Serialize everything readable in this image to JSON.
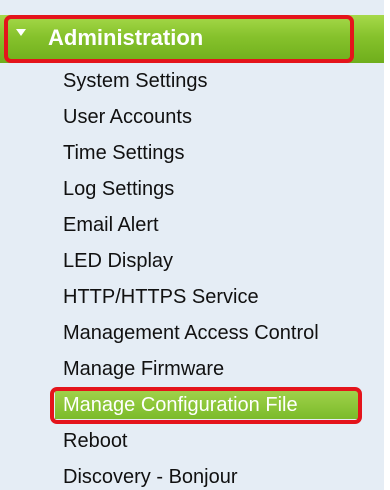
{
  "section": {
    "title": "Administration",
    "expanded_icon": "caret-down-icon"
  },
  "menu": {
    "items": [
      {
        "label": "System Settings"
      },
      {
        "label": "User Accounts"
      },
      {
        "label": "Time Settings"
      },
      {
        "label": "Log Settings"
      },
      {
        "label": "Email Alert"
      },
      {
        "label": "LED Display"
      },
      {
        "label": "HTTP/HTTPS Service"
      },
      {
        "label": "Management Access Control"
      },
      {
        "label": "Manage Firmware"
      },
      {
        "label": "Manage Configuration File"
      },
      {
        "label": "Reboot"
      },
      {
        "label": "Discovery - Bonjour"
      }
    ],
    "selected_label": "Manage Configuration File"
  },
  "colors": {
    "panel_background": "#e5edf5",
    "header_green": "#86c22c",
    "selected_green": "#7bbb2a",
    "callout_red": "#e4141b"
  }
}
